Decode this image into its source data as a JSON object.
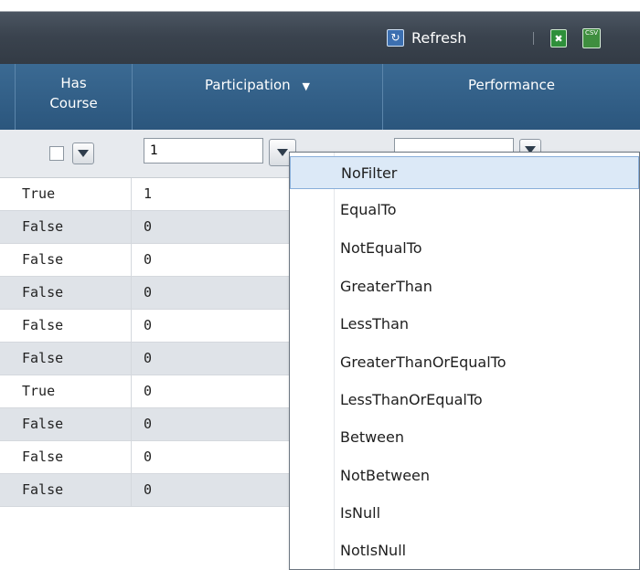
{
  "toolbar": {
    "refresh_label": "Refresh",
    "excel_icon": "excel-export-icon",
    "csv_label": "CSV"
  },
  "columns": {
    "has_course": "Has\nCourse",
    "participation": "Participation",
    "performance": "Performance"
  },
  "filters": {
    "participation_value": "1",
    "performance_value": ""
  },
  "rows": [
    {
      "has_course": "True",
      "participation": "1"
    },
    {
      "has_course": "False",
      "participation": "0"
    },
    {
      "has_course": "False",
      "participation": "0"
    },
    {
      "has_course": "False",
      "participation": "0"
    },
    {
      "has_course": "False",
      "participation": "0"
    },
    {
      "has_course": "False",
      "participation": "0"
    },
    {
      "has_course": "True",
      "participation": "0"
    },
    {
      "has_course": "False",
      "participation": "0"
    },
    {
      "has_course": "False",
      "participation": "0"
    },
    {
      "has_course": "False",
      "participation": "0"
    }
  ],
  "filter_menu": {
    "items": [
      "NoFilter",
      "EqualTo",
      "NotEqualTo",
      "GreaterThan",
      "LessThan",
      "GreaterThanOrEqualTo",
      "LessThanOrEqualTo",
      "Between",
      "NotBetween",
      "IsNull",
      "NotIsNull"
    ],
    "highlighted": "NoFilter"
  },
  "colors": {
    "header": "#3b6a93",
    "toolbar": "#3a434e",
    "highlight": "#dce9f7"
  }
}
